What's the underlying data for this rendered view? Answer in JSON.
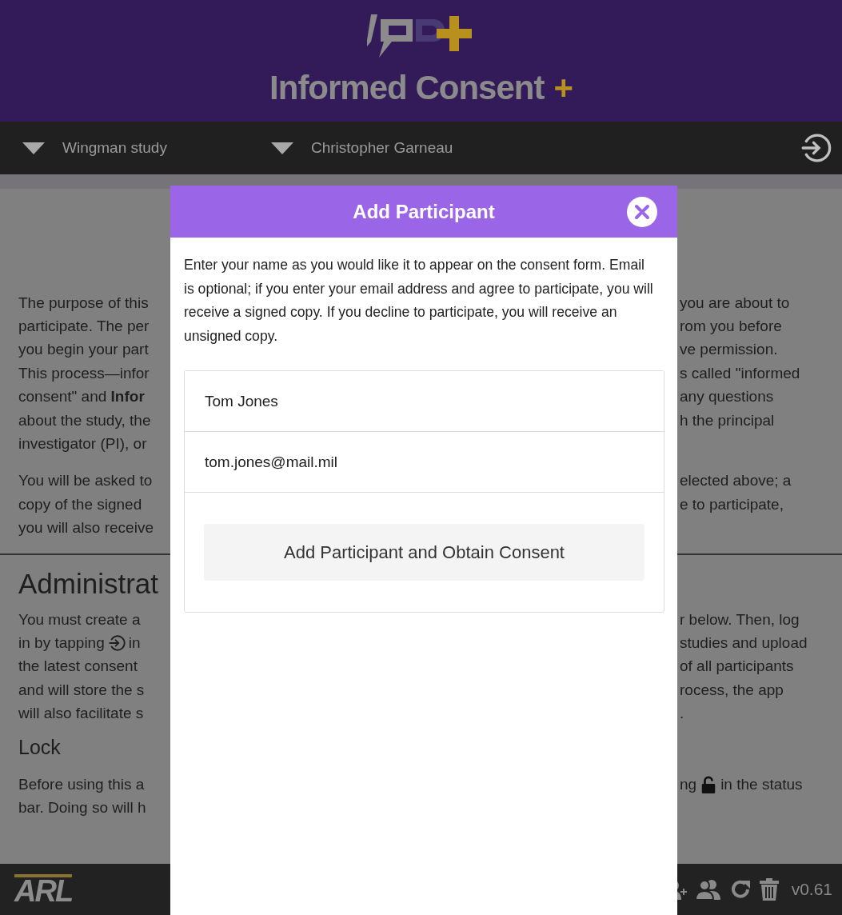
{
  "header": {
    "title": "Informed Consent",
    "title_mark": "+"
  },
  "nav": {
    "study": "Wingman study",
    "investigator": "Christopher Garneau"
  },
  "background": [
    {
      "kind": "paragraph",
      "lines": [
        {
          "left": "The purpose of this",
          "right": "you are about to"
        },
        {
          "left": "participate. The per",
          "right": "rom you before"
        },
        {
          "left": "you begin your part",
          "right": "ve permission."
        },
        {
          "left": "This process—infor",
          "right": "s called \"informed"
        },
        {
          "left": "consent\" and **Infor**",
          "right": "any questions"
        },
        {
          "left": "about the study, the",
          "right": "h the principal"
        },
        {
          "left": "investigator (PI), or"
        }
      ]
    },
    {
      "kind": "paragraph",
      "lines": [
        {
          "left": "You will be asked to",
          "right": "elected above; a"
        },
        {
          "left": "copy of the signed",
          "right": "e to participate,"
        },
        {
          "left": "you will also receive"
        }
      ]
    },
    {
      "kind": "divider"
    },
    {
      "kind": "heading",
      "text": "Administrat"
    },
    {
      "kind": "paragraph",
      "lines": [
        {
          "left": "You must create a",
          "right": "r below. Then, log"
        },
        {
          "left": [
            {
              "kind": "text",
              "text": "in by tapping"
            },
            {
              "kind": "login"
            },
            {
              "kind": "text",
              "text": "in"
            }
          ],
          "right": "studies and upload"
        },
        {
          "left": "the latest consent",
          "right": "of all participants"
        },
        {
          "left": "and will store the s",
          "right": "rocess, the app"
        },
        {
          "left": "will also facilitate s",
          "right": "."
        }
      ]
    },
    {
      "kind": "subheading",
      "text": "Lock"
    },
    {
      "kind": "paragraph",
      "lines": [
        {
          "left": "Before using this a",
          "right": [
            {
              "kind": "text",
              "text": "ng"
            },
            {
              "kind": "lock"
            },
            {
              "kind": "text",
              "text": "in the status"
            }
          ]
        },
        {
          "left": "bar. Doing so will h"
        }
      ]
    }
  ],
  "modal": {
    "title": "Add Participant",
    "intro": "Enter your name as you would like it to appear on the consent form. Email is optional; if you enter your email address and agree to participate, you will receive a signed copy. If you decline to participate, you will receive an unsigned copy.",
    "name": "Tom Jones",
    "email": "tom.jones@mail.mil",
    "button": "Add Participant and Obtain Consent"
  },
  "footer": {
    "logo": "ARL",
    "version": "v0.61"
  }
}
